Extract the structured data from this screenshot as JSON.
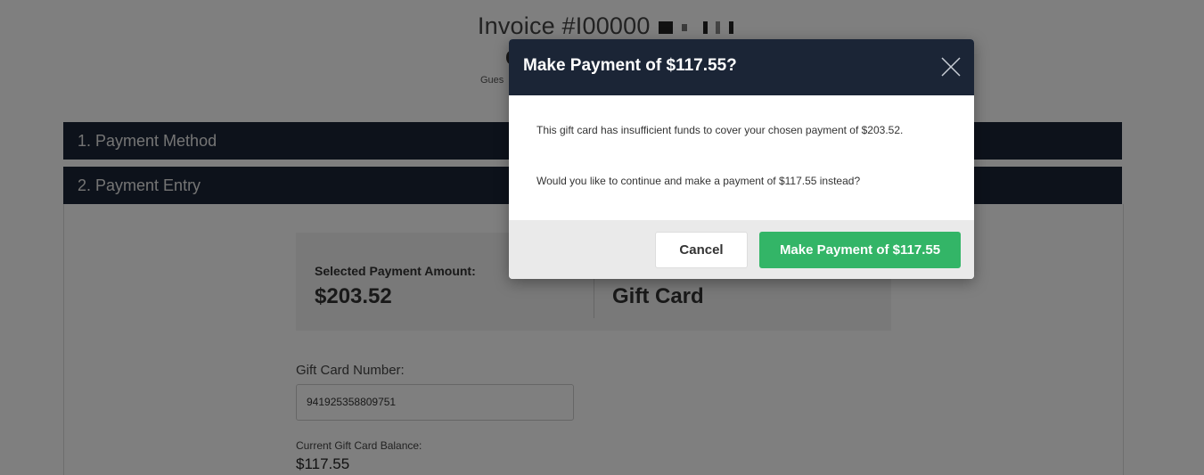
{
  "invoice": {
    "title": "Invoice #I00000",
    "sub_letter": "C",
    "guest_text": "Gues"
  },
  "sections": {
    "payment_method": "1. Payment Method",
    "payment_entry": "2. Payment Entry"
  },
  "entry": {
    "selected_label": "Selected Payment Amount:",
    "selected_amount": "$203.52",
    "method": "Gift Card",
    "gift_card_label": "Gift Card Number:",
    "gift_card_number": "941925358809751",
    "balance_label": "Current Gift Card Balance:",
    "balance_value": "$117.55"
  },
  "modal": {
    "title": "Make Payment of $117.55?",
    "message_line1": "This gift card has insufficient funds to cover your chosen payment of $203.52.",
    "message_line2": "Would you like to continue and make a payment of $117.55 instead?",
    "cancel_label": "Cancel",
    "confirm_label": "Make Payment of $117.55"
  },
  "colors": {
    "header_dark": "#1b2536",
    "confirm_green": "#33b567"
  },
  "icons": {
    "close": "close-icon"
  }
}
